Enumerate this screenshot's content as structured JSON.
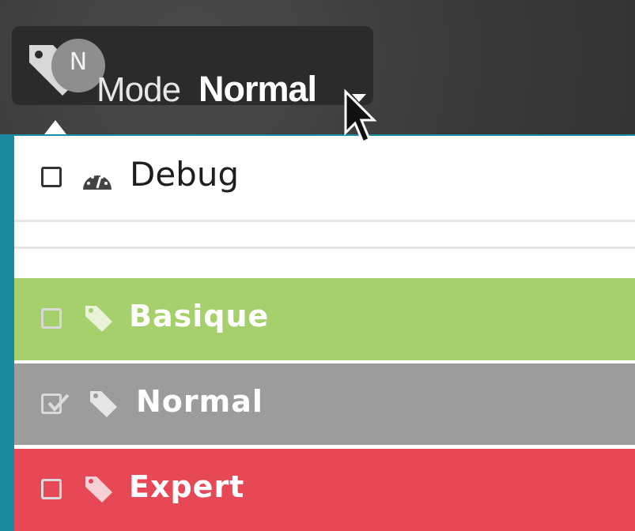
{
  "mode_selector": {
    "prefix": "Mode",
    "value": "Normal",
    "avatar_letter": "N"
  },
  "menu": {
    "items": [
      {
        "label": "Debug",
        "checked": false,
        "icon": "gauge-icon",
        "color": "#ffffff"
      },
      {
        "label": "Basique",
        "checked": false,
        "icon": "tag-icon",
        "color": "#a5d06c"
      },
      {
        "label": "Normal",
        "checked": true,
        "icon": "tag-icon",
        "color": "#9c9c9c"
      },
      {
        "label": "Expert",
        "checked": false,
        "icon": "tag-icon",
        "color": "#e64855"
      }
    ]
  }
}
